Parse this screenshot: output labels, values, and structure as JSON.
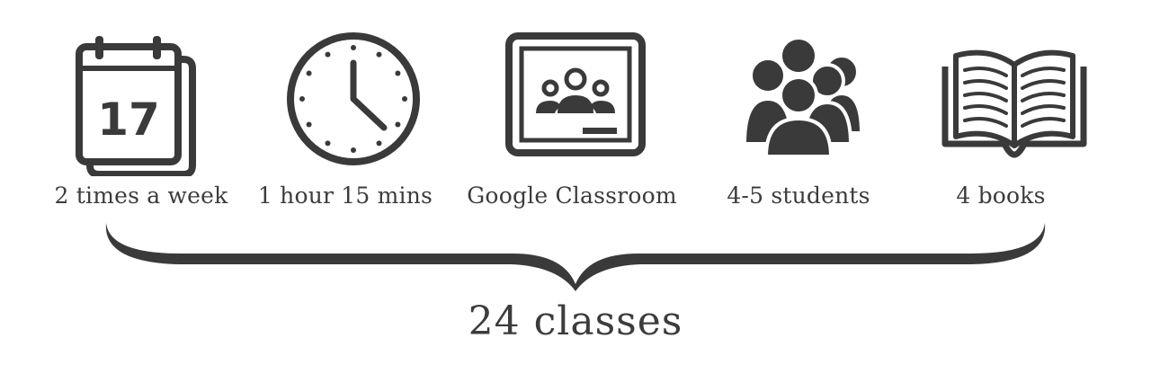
{
  "items": [
    {
      "icon": "calendar-icon",
      "label": "2 times a week",
      "day_number": "17"
    },
    {
      "icon": "clock-icon",
      "label": "1 hour 15 mins"
    },
    {
      "icon": "google-classroom-icon",
      "label": "Google Classroom"
    },
    {
      "icon": "group-of-people-icon",
      "label": "4-5 students"
    },
    {
      "icon": "open-book-icon",
      "label": "4 books"
    }
  ],
  "total": "24 classes",
  "colors": {
    "icon": "#3a3a3a",
    "text": "#3c3c3c",
    "background": "#ffffff"
  }
}
